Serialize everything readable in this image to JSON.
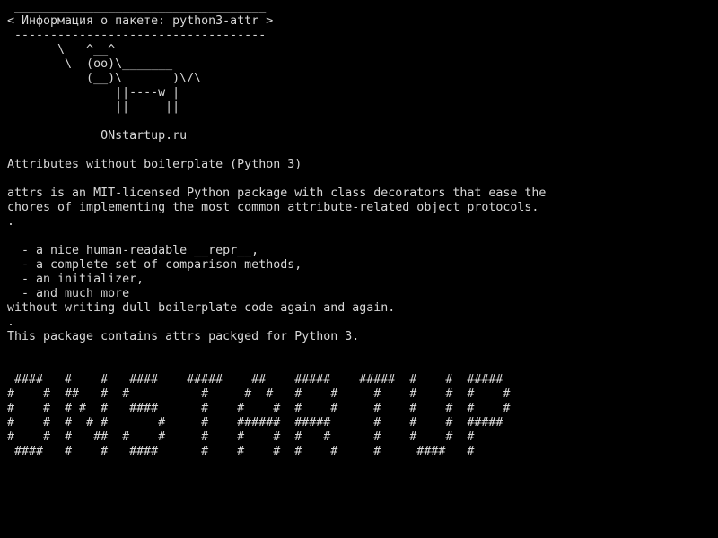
{
  "colors": {
    "background": "#000000",
    "foreground": "#d8d8d8"
  },
  "terminal": {
    "lines": [
      " ___________________________________",
      "< Информация о пакете: python3-attr >",
      " -----------------------------------",
      "       \\   ^__^",
      "        \\  (oo)\\_______",
      "           (__)\\       )\\/\\",
      "               ||----w |",
      "               ||     ||",
      "",
      "             ONstartup.ru",
      "",
      "Attributes without boilerplate (Python 3)",
      "",
      "attrs is an MIT-licensed Python package with class decorators that ease the",
      "chores of implementing the most common attribute-related object protocols.",
      ".",
      "",
      "  - a nice human-readable __repr__,",
      "  - a complete set of comparison methods,",
      "  - an initializer,",
      "  - and much more",
      "without writing dull boilerplate code again and again.",
      ".",
      "This package contains attrs packged for Python 3.",
      "",
      "",
      " ####   #    #   ####    #####    ##    #####    #####  #    #  #####",
      "#    #  ##   #  #          #     #  #   #    #     #    #    #  #    #",
      "#    #  # #  #   ####      #    #    #  #    #     #    #    #  #    #",
      "#    #  #  # #       #     #    ######  #####      #    #    #  #####",
      "#    #  #   ##  #    #     #    #    #  #   #      #    #    #  #",
      " ####   #    #   ####      #    #    #  #    #     #     ####   #"
    ]
  }
}
